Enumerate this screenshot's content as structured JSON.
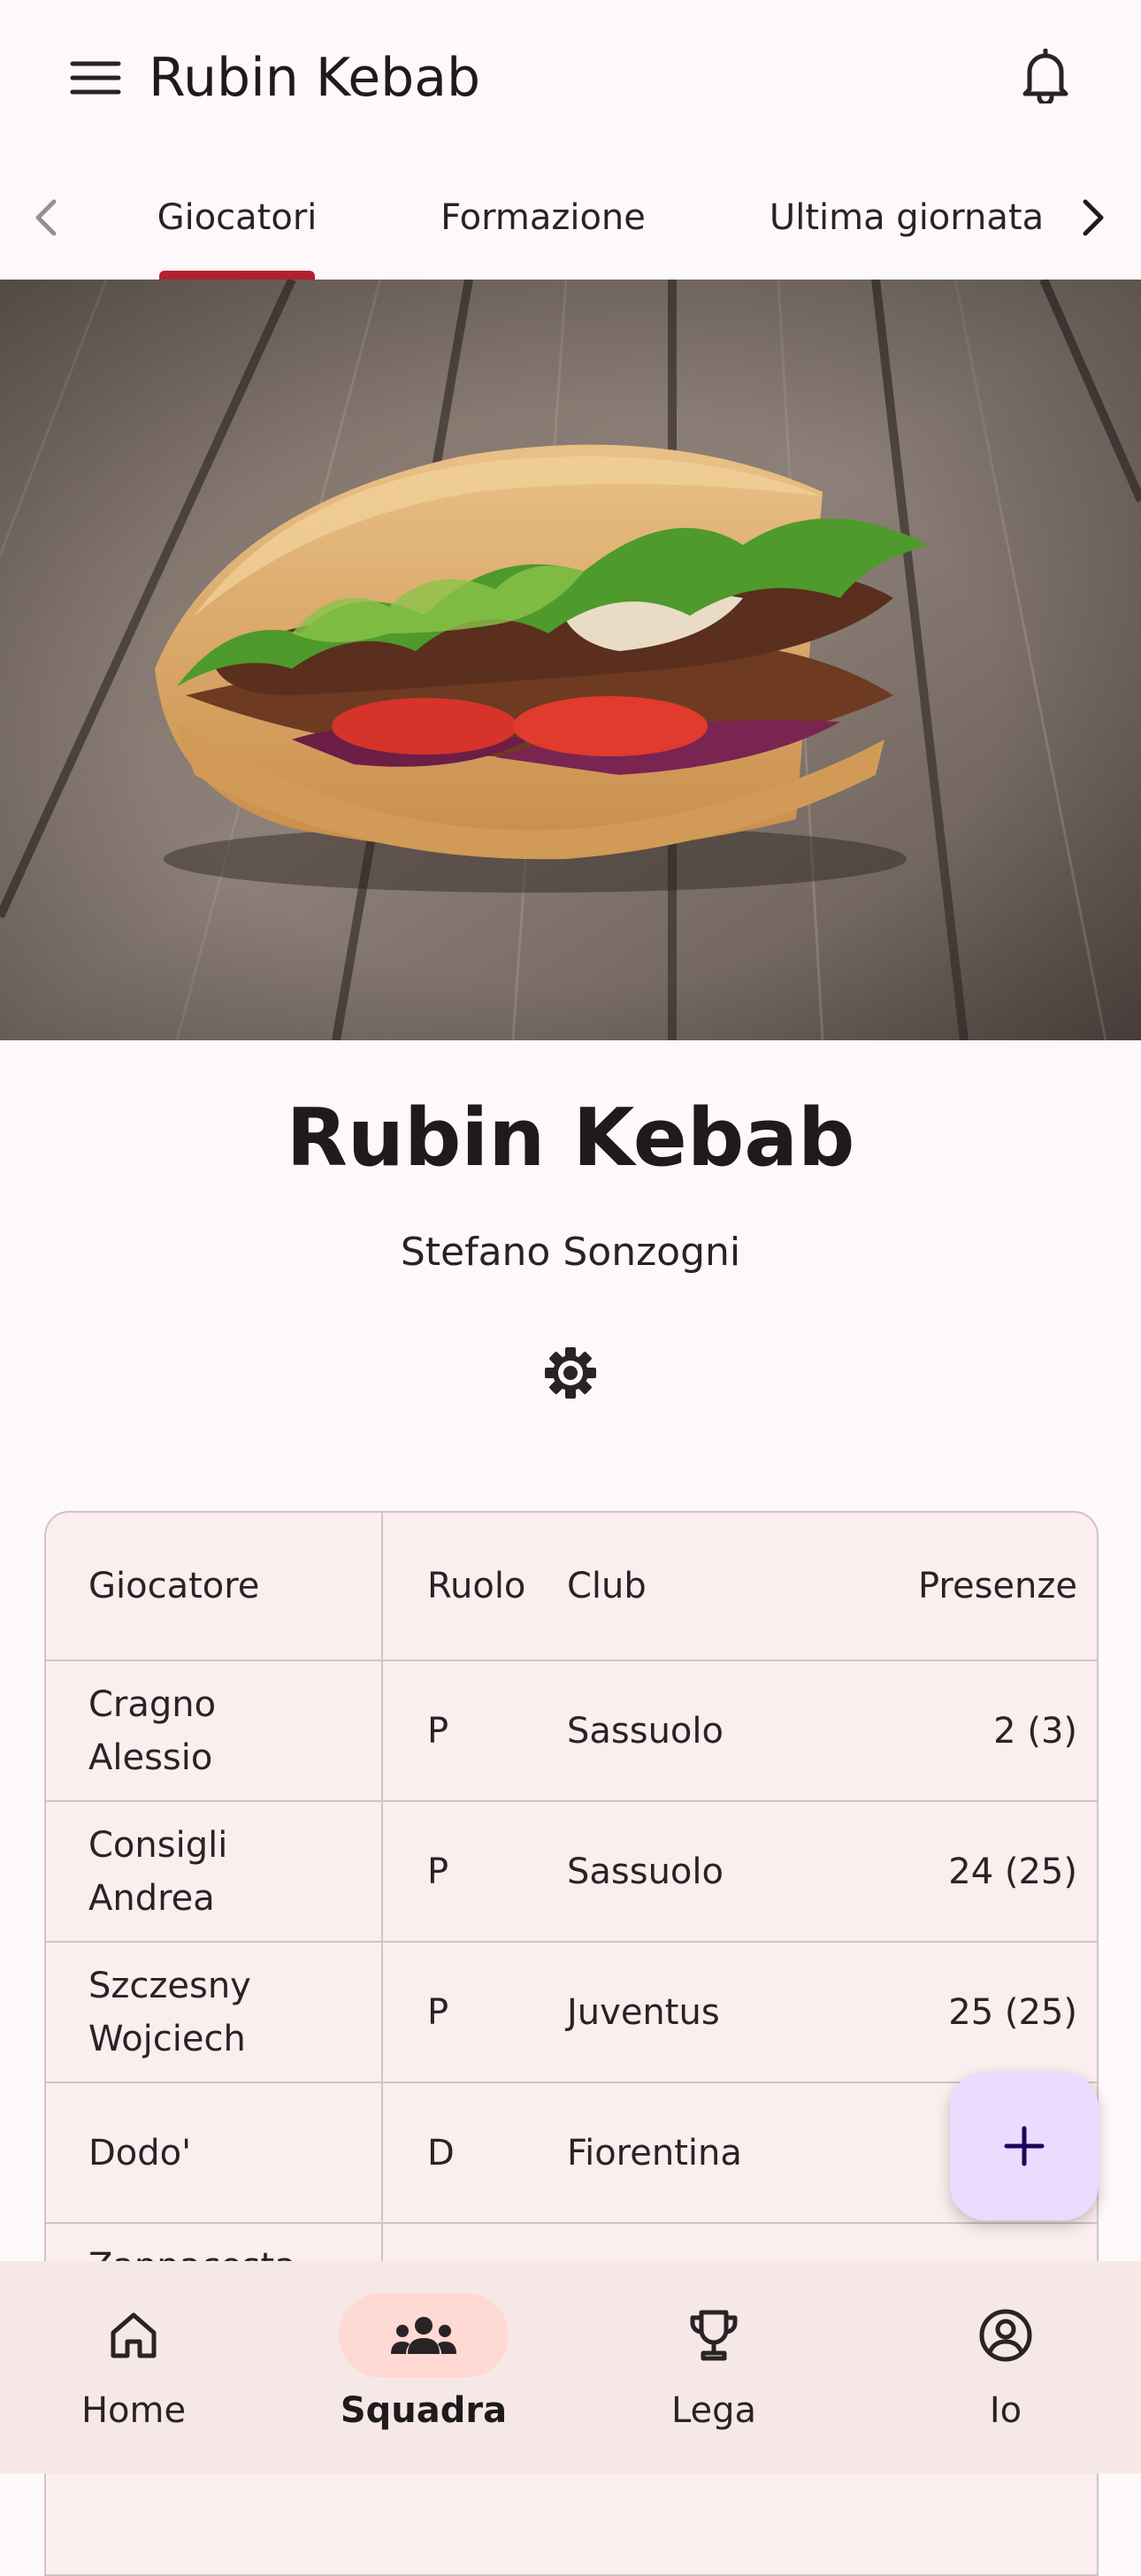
{
  "app_bar": {
    "title": "Rubin Kebab",
    "menu_icon": "menu-icon",
    "notifications_icon": "bell-icon"
  },
  "tabs": {
    "items": [
      {
        "label": "Giocatori",
        "selected": true
      },
      {
        "label": "Formazione",
        "selected": false
      },
      {
        "label": "Ultima giornata",
        "selected": false
      }
    ],
    "prev_icon": "chevron-left-icon",
    "next_icon": "chevron-right-icon"
  },
  "team": {
    "name": "Rubin Kebab",
    "owner": "Stefano Sonzogni",
    "settings_icon": "gear-icon"
  },
  "players_table": {
    "headers": {
      "player": "Giocatore",
      "role": "Ruolo",
      "club": "Club",
      "appearances": "Presenze"
    },
    "rows": [
      {
        "player_line1": "Cragno",
        "player_line2": "Alessio",
        "role": "P",
        "club": "Sassuolo",
        "appearances": "2 (3)"
      },
      {
        "player_line1": "Consigli",
        "player_line2": "Andrea",
        "role": "P",
        "club": "Sassuolo",
        "appearances": "24 (25)"
      },
      {
        "player_line1": "Szczesny",
        "player_line2": "Wojciech",
        "role": "P",
        "club": "Juventus",
        "appearances": "25 (25)"
      },
      {
        "player_line1": "Dodo'",
        "player_line2": "",
        "role": "D",
        "club": "Fiorentina",
        "appearances": ""
      },
      {
        "player_line1": "Zappacosta",
        "player_line2": "",
        "role": "",
        "club": "",
        "appearances": ""
      }
    ]
  },
  "fab": {
    "icon": "plus-icon"
  },
  "bottom_nav": {
    "items": [
      {
        "label": "Home",
        "icon": "home-icon",
        "active": false
      },
      {
        "label": "Squadra",
        "icon": "group-icon",
        "active": true
      },
      {
        "label": "Lega",
        "icon": "trophy-icon",
        "active": false
      },
      {
        "label": "Io",
        "icon": "account-icon",
        "active": false
      }
    ]
  },
  "colors": {
    "accent": "#b3202f",
    "background": "#fdf8fa",
    "table_bg": "#fbeeee",
    "fab_bg": "#eadbff",
    "nav_bg": "#f7e8e8",
    "nav_active_pill": "#ffd9d4"
  }
}
